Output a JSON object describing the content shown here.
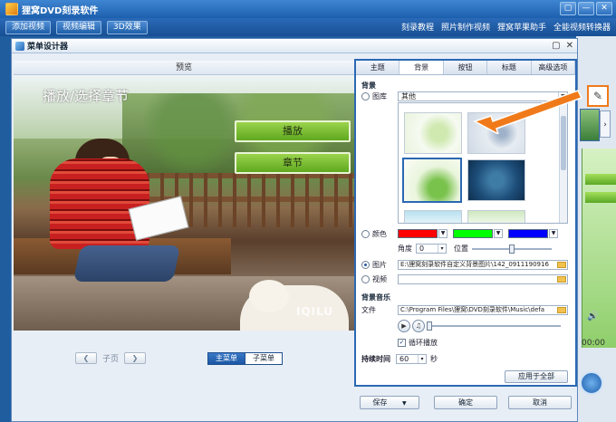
{
  "app": {
    "title": "狸窝DVD刻录软件",
    "window_buttons": [
      "▢",
      "—",
      "✕"
    ],
    "tabs": [
      "添加视频",
      "视频编辑",
      "3D效果"
    ],
    "links": [
      "刻录教程",
      "照片制作视频",
      "狸窝苹果助手",
      "全能视频转换器"
    ]
  },
  "dialog": {
    "title": "菜单设计器",
    "window_buttons": [
      "▢",
      "✕"
    ],
    "preview_label": "预览",
    "menu_title": "播放/选择章节",
    "play_button": "播放",
    "chapter_button": "章节",
    "watermark": "IQILU",
    "pager": {
      "prev": "❮",
      "label": "子页",
      "next": "❯"
    },
    "menu_switch": {
      "main": "主菜单",
      "sub": "子菜单"
    }
  },
  "panel": {
    "tabs": [
      "主题",
      "背景",
      "按钮",
      "标题",
      "高级选项"
    ],
    "active_tab": 1,
    "background_section": "背景",
    "gallery_label": "图库",
    "gallery_select": "其他",
    "color_label": "颜色",
    "colors": [
      "#ff0000",
      "#00ff00",
      "#0000ff"
    ],
    "angle_label": "角度",
    "angle_value": "0",
    "position_label": "位置",
    "position_value": 0.5,
    "image_label": "图片",
    "image_path": "E:\\狸窝刻录软件自定义背景图片\\142_0911190916",
    "video_label": "视频",
    "video_path": "",
    "music_section": "背景音乐",
    "file_label": "文件",
    "file_path": "C:\\Program Files\\狸窝\\DVD刻录软件\\Music\\defa",
    "loop_label": "循环播放",
    "loop_checked": true,
    "duration_label": "持续时间",
    "duration_value": "60",
    "duration_unit": "秒",
    "apply_all": "应用于全部"
  },
  "footer": {
    "save": "保存",
    "ok": "确定",
    "cancel": "取消"
  },
  "main_peek": {
    "volume_icon": "🔊",
    "time": "00:00"
  }
}
